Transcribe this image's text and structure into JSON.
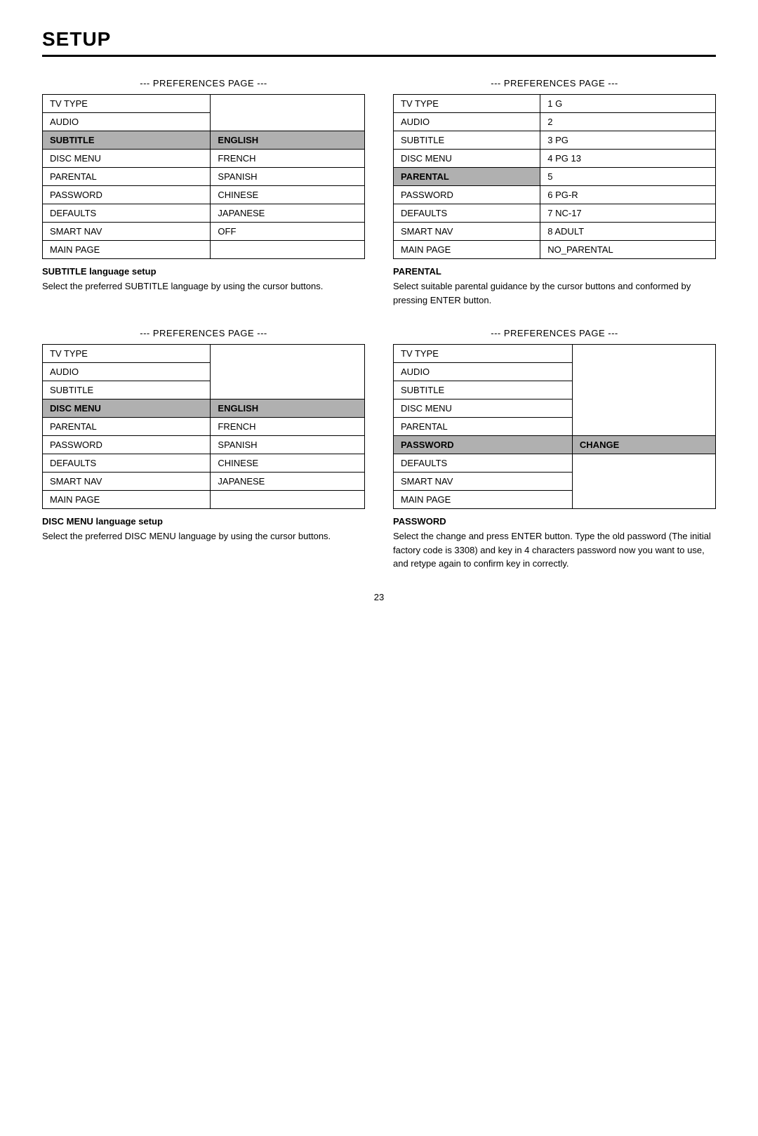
{
  "page": {
    "title": "SETUP",
    "page_number": "23"
  },
  "sections": [
    {
      "id": "top-left",
      "pref_label": "--- PREFERENCES PAGE ---",
      "rows": [
        {
          "col1": "TV TYPE",
          "col2": "",
          "col1_selected": false,
          "col2_selected": false
        },
        {
          "col1": "AUDIO",
          "col2": "",
          "col1_selected": false,
          "col2_selected": false
        },
        {
          "col1": "SUBTITLE",
          "col2": "ENGLISH",
          "col1_selected": true,
          "col2_selected": true
        },
        {
          "col1": "DISC MENU",
          "col2": "FRENCH",
          "col1_selected": false,
          "col2_selected": false
        },
        {
          "col1": "PARENTAL",
          "col2": "SPANISH",
          "col1_selected": false,
          "col2_selected": false
        },
        {
          "col1": "PASSWORD",
          "col2": "CHINESE",
          "col1_selected": false,
          "col2_selected": false
        },
        {
          "col1": "DEFAULTS",
          "col2": "JAPANESE",
          "col1_selected": false,
          "col2_selected": false
        },
        {
          "col1": "SMART NAV",
          "col2": "OFF",
          "col1_selected": false,
          "col2_selected": false
        },
        {
          "col1": "MAIN PAGE",
          "col2": "",
          "col1_selected": false,
          "col2_selected": false
        }
      ],
      "desc_title": "SUBTITLE language setup",
      "desc_text": "Select the preferred SUBTITLE language by using the cursor buttons."
    },
    {
      "id": "top-right",
      "pref_label": "--- PREFERENCES PAGE ---",
      "rows": [
        {
          "col1": "TV TYPE",
          "col2": "1 G",
          "col1_selected": false,
          "col2_selected": false
        },
        {
          "col1": "AUDIO",
          "col2": "2",
          "col1_selected": false,
          "col2_selected": false
        },
        {
          "col1": "SUBTITLE",
          "col2": "3 PG",
          "col1_selected": false,
          "col2_selected": false
        },
        {
          "col1": "DISC MENU",
          "col2": "4 PG 13",
          "col1_selected": false,
          "col2_selected": false
        },
        {
          "col1": "PARENTAL",
          "col2": "5",
          "col1_selected": true,
          "col2_selected": false
        },
        {
          "col1": "PASSWORD",
          "col2": "6 PG-R",
          "col1_selected": false,
          "col2_selected": false
        },
        {
          "col1": "DEFAULTS",
          "col2": "7 NC-17",
          "col1_selected": false,
          "col2_selected": false
        },
        {
          "col1": "SMART NAV",
          "col2": "8 ADULT",
          "col1_selected": false,
          "col2_selected": false
        },
        {
          "col1": "MAIN PAGE",
          "col2": "NO_PARENTAL",
          "col1_selected": false,
          "col2_selected": false
        }
      ],
      "desc_title": "PARENTAL",
      "desc_text": "Select suitable parental guidance by the cursor buttons and conformed by pressing ENTER button."
    },
    {
      "id": "bottom-left",
      "pref_label": "--- PREFERENCES PAGE ---",
      "rows": [
        {
          "col1": "TV TYPE",
          "col2": "",
          "col1_selected": false,
          "col2_selected": false
        },
        {
          "col1": "AUDIO",
          "col2": "",
          "col1_selected": false,
          "col2_selected": false
        },
        {
          "col1": "SUBTITLE",
          "col2": "",
          "col1_selected": false,
          "col2_selected": false
        },
        {
          "col1": "DISC MENU",
          "col2": "ENGLISH",
          "col1_selected": true,
          "col2_selected": true
        },
        {
          "col1": "PARENTAL",
          "col2": "FRENCH",
          "col1_selected": false,
          "col2_selected": false
        },
        {
          "col1": "PASSWORD",
          "col2": "SPANISH",
          "col1_selected": false,
          "col2_selected": false
        },
        {
          "col1": "DEFAULTS",
          "col2": "CHINESE",
          "col1_selected": false,
          "col2_selected": false
        },
        {
          "col1": "SMART NAV",
          "col2": "JAPANESE",
          "col1_selected": false,
          "col2_selected": false
        },
        {
          "col1": "MAIN PAGE",
          "col2": "",
          "col1_selected": false,
          "col2_selected": false
        }
      ],
      "desc_title": "DISC MENU language setup",
      "desc_text": "Select the preferred DISC MENU language by using the cursor buttons."
    },
    {
      "id": "bottom-right",
      "pref_label": "--- PREFERENCES PAGE ---",
      "rows": [
        {
          "col1": "TV TYPE",
          "col2": "",
          "col1_selected": false,
          "col2_selected": false
        },
        {
          "col1": "AUDIO",
          "col2": "",
          "col1_selected": false,
          "col2_selected": false
        },
        {
          "col1": "SUBTITLE",
          "col2": "",
          "col1_selected": false,
          "col2_selected": false
        },
        {
          "col1": "DISC MENU",
          "col2": "",
          "col1_selected": false,
          "col2_selected": false
        },
        {
          "col1": "PARENTAL",
          "col2": "",
          "col1_selected": false,
          "col2_selected": false
        },
        {
          "col1": "PASSWORD",
          "col2": "CHANGE",
          "col1_selected": true,
          "col2_selected": true
        },
        {
          "col1": "DEFAULTS",
          "col2": "",
          "col1_selected": false,
          "col2_selected": false
        },
        {
          "col1": "SMART NAV",
          "col2": "",
          "col1_selected": false,
          "col2_selected": false
        },
        {
          "col1": "MAIN PAGE",
          "col2": "",
          "col1_selected": false,
          "col2_selected": false
        }
      ],
      "desc_title": "PASSWORD",
      "desc_text": "Select the change and press ENTER button. Type the old password (The initial factory code is 3308) and key in 4 characters password now you want to use, and retype again to confirm key in correctly."
    }
  ]
}
